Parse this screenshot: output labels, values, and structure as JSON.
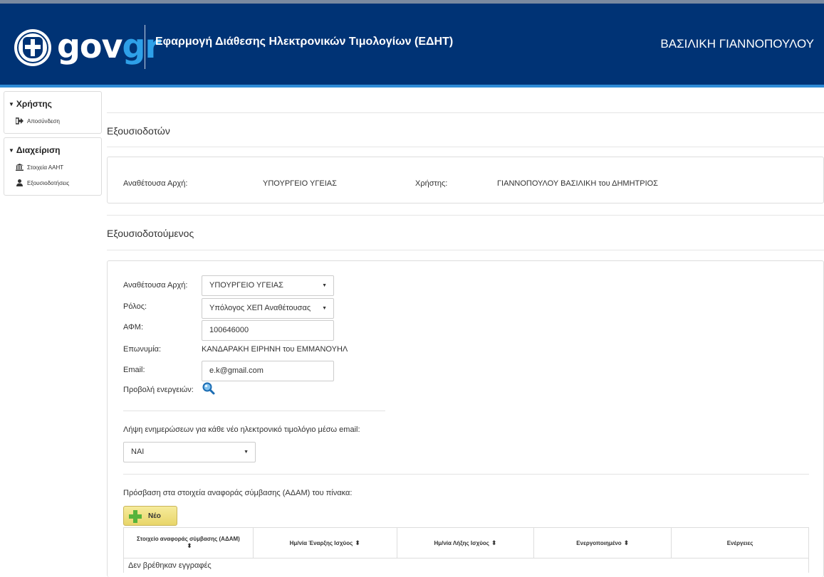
{
  "header": {
    "logo_gov": "gov",
    "logo_gr": "gr",
    "app_title": "Εφαρμογή Διάθεσης Ηλεκτρονικών Τιμολογίων (ΕΔΗΤ)",
    "user_name": "ΒΑΣΙΛΙΚΗ ΓΙΑΝΝΟΠΟΥΛΟΥ",
    "colors": {
      "header_bg": "#003375",
      "accent": "#2e8bd6",
      "logo_gr": "#2ea0e8"
    }
  },
  "sidebar": {
    "groups": [
      {
        "title": "Χρήστης",
        "items": [
          {
            "label": "Αποσύνδεση",
            "icon": "logout-icon"
          }
        ]
      },
      {
        "title": "Διαχείριση",
        "items": [
          {
            "label": "Στοιχεία ΑΑΗΤ",
            "icon": "institution-icon"
          },
          {
            "label": "Εξουσιοδοτήσεις",
            "icon": "user-icon"
          }
        ]
      }
    ]
  },
  "authorizer": {
    "section_title": "Εξουσιοδοτών",
    "authority_label": "Αναθέτουσα Αρχή:",
    "authority_value": "ΥΠΟΥΡΓΕΙΟ ΥΓΕΙΑΣ",
    "user_label": "Χρήστης:",
    "user_value": "ΓΙΑΝΝΟΠΟΥΛΟΥ ΒΑΣΙΛΙΚΗ του ΔΗΜΗΤΡΙΟΣ"
  },
  "authorized": {
    "section_title": "Εξουσιοδοτούμενος",
    "authority_label": "Αναθέτουσα Αρχή:",
    "authority_selected": "ΥΠΟΥΡΓΕΙΟ ΥΓΕΙΑΣ",
    "role_label": "Ρόλος:",
    "role_selected": "Υπόλογος ΧΕΠ Αναθέτουσας",
    "afm_label": "ΑΦΜ:",
    "afm_value": "100646000",
    "name_label": "Επωνυμία:",
    "name_value": "ΚΑΝΔΑΡΑΚΗ ΕΙΡΗΝΗ του ΕΜΜΑΝΟΥΗΛ",
    "email_label": "Email:",
    "email_value": "e.k@gmail.com",
    "actions_label": "Προβολή ενεργειών:",
    "notify_label": "Λήψη ενημερώσεων για κάθε νέο ηλεκτρονικό τιμολόγιο μέσω email:",
    "notify_selected": "ΝΑΙ",
    "access_label": "Πρόσβαση στα στοιχεία αναφοράς σύμβασης (ΑΔΑΜ) του πίνακα:",
    "new_button": "Νέο"
  },
  "table": {
    "columns": [
      "Στοιχείο αναφοράς σύμβασης (ΑΔΑΜ)",
      "Ημ/νία Έναρξης Ισχύος",
      "Ημ/νία Λήξης Ισχύος",
      "Ενεργοποιημένο",
      "Ενέργειες"
    ],
    "empty_text": "Δεν βρέθηκαν εγγραφές"
  }
}
